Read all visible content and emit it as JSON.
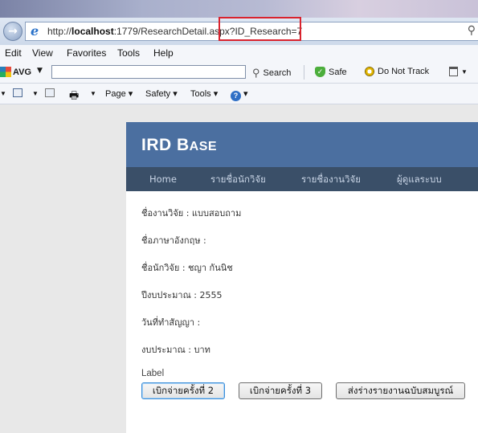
{
  "browser": {
    "address": {
      "prefix": "http://",
      "host": "localhost",
      "path": ":1779/ResearchDetail.aspx?ID_Research=7"
    },
    "menu": [
      "Edit",
      "View",
      "Favorites",
      "Tools",
      "Help"
    ],
    "avg_toolbar": {
      "brand": "AVG",
      "search_label": "Search",
      "safe_label": "Safe",
      "dnt_label": "Do Not Track"
    },
    "command_bar": {
      "page_label": "Page",
      "safety_label": "Safety",
      "tools_label": "Tools"
    }
  },
  "site": {
    "title_big1": "IRD B",
    "title_small": "ASE",
    "nav": [
      "Home",
      "รายชื่อนักวิจัย",
      "รายชื่องานวิจัย",
      "ผู้ดูแลระบบ"
    ],
    "fields": [
      "ชื่องานวิจัย : แบบสอบถาม",
      "ชื่อภาษาอังกฤษ :",
      "ชื่อนักวิจัย : ชญา กันนิช",
      "ปีงบประมาณ : 2555",
      "วันที่ทำสัญญา :",
      "งบประมาณ : บาท"
    ],
    "label_text": "Label",
    "buttons": [
      "เบิกจ่ายครั้งที่ 2",
      "เบิกจ่ายครั้งที่ 3",
      "ส่งร่างรายงานฉบับสมบูรณ์"
    ]
  },
  "colors": {
    "header_bg": "#4b6fa0",
    "nav_bg": "#3a4f68",
    "highlight": "#d9232e"
  }
}
